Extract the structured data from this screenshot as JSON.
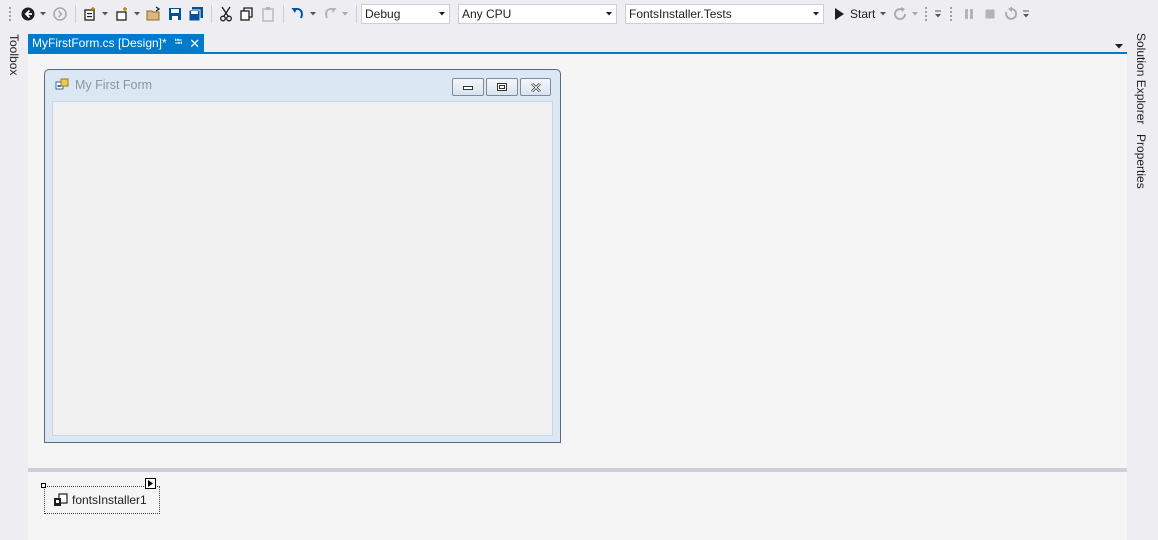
{
  "toolbar": {
    "configuration": "Debug",
    "platform": "Any CPU",
    "startup_project": "FontsInstaller.Tests",
    "start_label": "Start"
  },
  "side_panels": {
    "left": [
      "Toolbox"
    ],
    "right": [
      "Solution Explorer",
      "Properties"
    ]
  },
  "document_tab": {
    "title": "MyFirstForm.cs [Design]*"
  },
  "form": {
    "title": "My First Form"
  },
  "component_tray": {
    "items": [
      {
        "label": "fontsInstaller1",
        "icon": "component-icon"
      }
    ]
  },
  "colors": {
    "accent": "#007acc",
    "chrome": "#eeeef2",
    "designer_bg": "#f5f5f5"
  }
}
